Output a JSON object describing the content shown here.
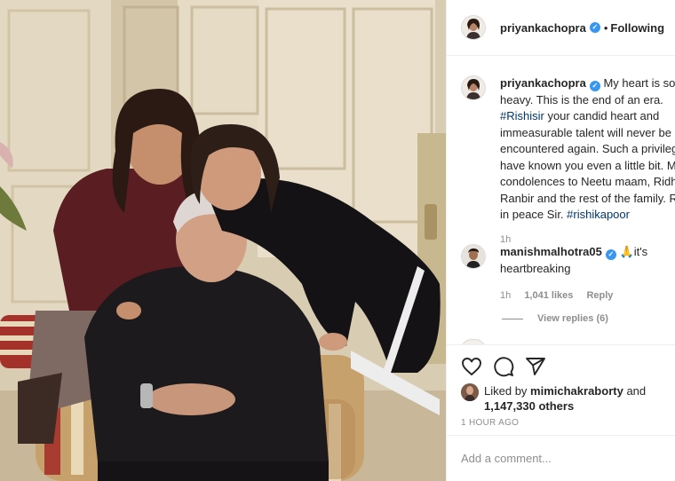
{
  "post": {
    "username": "priyankachopra",
    "following_label": "Following",
    "caption": {
      "username": "priyankachopra",
      "text_before": "My heart is so heavy. This is the end of an era. ",
      "hashtag_1": "#Rishisir",
      "text_after": " your candid heart and immeasurable talent will never be encountered again. Such a privilege to have known you even a little bit. My condolences to Neetu maam, Ridhima, Ranbir and the rest of the family. Rest in peace Sir. ",
      "hashtag_2": "#rishikapoor",
      "time": "1h"
    },
    "comment": {
      "username": "manishmalhotra05",
      "emoji": "🙏",
      "text": "it's heartbreaking",
      "time": "1h",
      "likes": "1,041 likes",
      "reply_label": "Reply",
      "view_replies": "View replies (6)"
    },
    "likes": {
      "prefix": "Liked by",
      "user": "mimichakraborty",
      "conj": "and",
      "count": "1,147,330 others"
    },
    "timestamp": "1 HOUR AGO",
    "add_comment_placeholder": "Add a comment...",
    "icons": {
      "like": "heart-icon",
      "comment": "comment-bubble-icon",
      "share": "share-paper-plane-icon",
      "verified": "verified-badge-icon"
    },
    "colors": {
      "verified": "#3897f0",
      "link": "#00376b",
      "muted": "#8e8e8e"
    }
  }
}
